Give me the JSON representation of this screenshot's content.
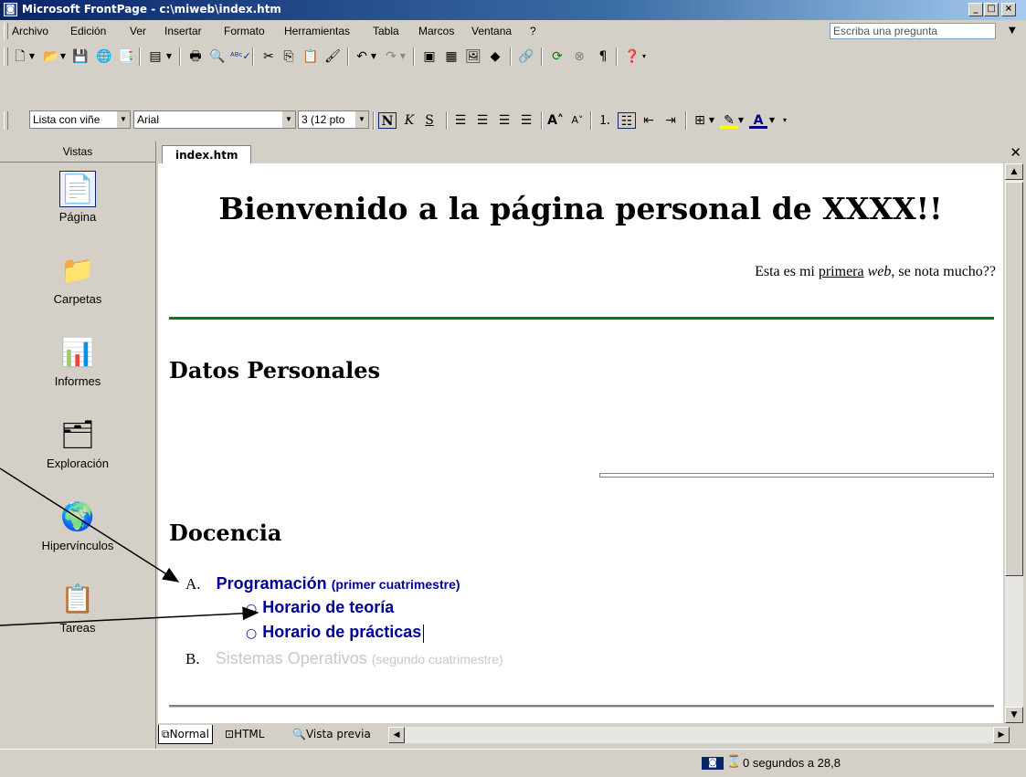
{
  "window": {
    "title": "Microsoft FrontPage - c:\\miweb\\index.htm",
    "caption_buttons": [
      "_",
      "□",
      "×"
    ]
  },
  "menu": {
    "items": [
      "Archivo",
      "Edición",
      "Ver",
      "Insertar",
      "Formato",
      "Herramientas",
      "Tabla",
      "Marcos",
      "Ventana",
      "?"
    ],
    "ask_placeholder": "Escriba una pregunta"
  },
  "toolbar": {
    "standard_icons": [
      "new-icon",
      "open-icon",
      "save-icon",
      "publish-icon",
      "folder-list-icon",
      "print-icon",
      "preview-icon",
      "spelling-icon",
      "cut-icon",
      "copy-icon",
      "paste-icon",
      "format-painter-icon",
      "undo-icon",
      "redo-icon",
      "web-component-icon",
      "table-icon",
      "picture-icon",
      "drawing-icon",
      "hyperlink-icon",
      "refresh-icon",
      "stop-icon",
      "paragraph-icon",
      "help-icon"
    ],
    "style_value": "Lista con viñe",
    "font_value": "Arial",
    "size_value": "3 (12 pto",
    "formatting": {
      "bold": "N",
      "italic": "K",
      "underline": "S"
    }
  },
  "views": {
    "header": "Vistas",
    "items": [
      {
        "label": "Página",
        "icon": "page-view-icon",
        "selected": true
      },
      {
        "label": "Carpetas",
        "icon": "folders-view-icon"
      },
      {
        "label": "Informes",
        "icon": "reports-view-icon"
      },
      {
        "label": "Exploración",
        "icon": "navigation-view-icon"
      },
      {
        "label": "Hipervínculos",
        "icon": "hyperlinks-view-icon"
      },
      {
        "label": "Tareas",
        "icon": "tasks-view-icon"
      }
    ]
  },
  "document": {
    "tab": "index.htm",
    "heading": "Bienvenido a la página personal de XXXX!!",
    "subtitle": {
      "before": "Esta es mi ",
      "link": "primera",
      "italic": "web",
      "after": ", se nota mucho??"
    },
    "section1": "Datos Personales",
    "section2": "Docencia",
    "list": [
      {
        "marker": "A.",
        "title": "Programación",
        "note": "(primer cuatrimestre)",
        "subitems": [
          "Horario de teoría",
          "Horario de prácticas"
        ]
      },
      {
        "marker": "B.",
        "title": "Sistemas Operativos",
        "note": "(segundo cuatrimestre)"
      }
    ]
  },
  "view_tabs": [
    "Normal",
    "HTML",
    "Vista previa"
  ],
  "status": {
    "text": "0 segundos a 28,8"
  },
  "colors": {
    "title_gradient_start": "#0a246a",
    "title_gradient_end": "#a6caf0",
    "link_blue": "#000099",
    "hr_green": "#008000",
    "disabled_gray": "#c8c8c8"
  }
}
